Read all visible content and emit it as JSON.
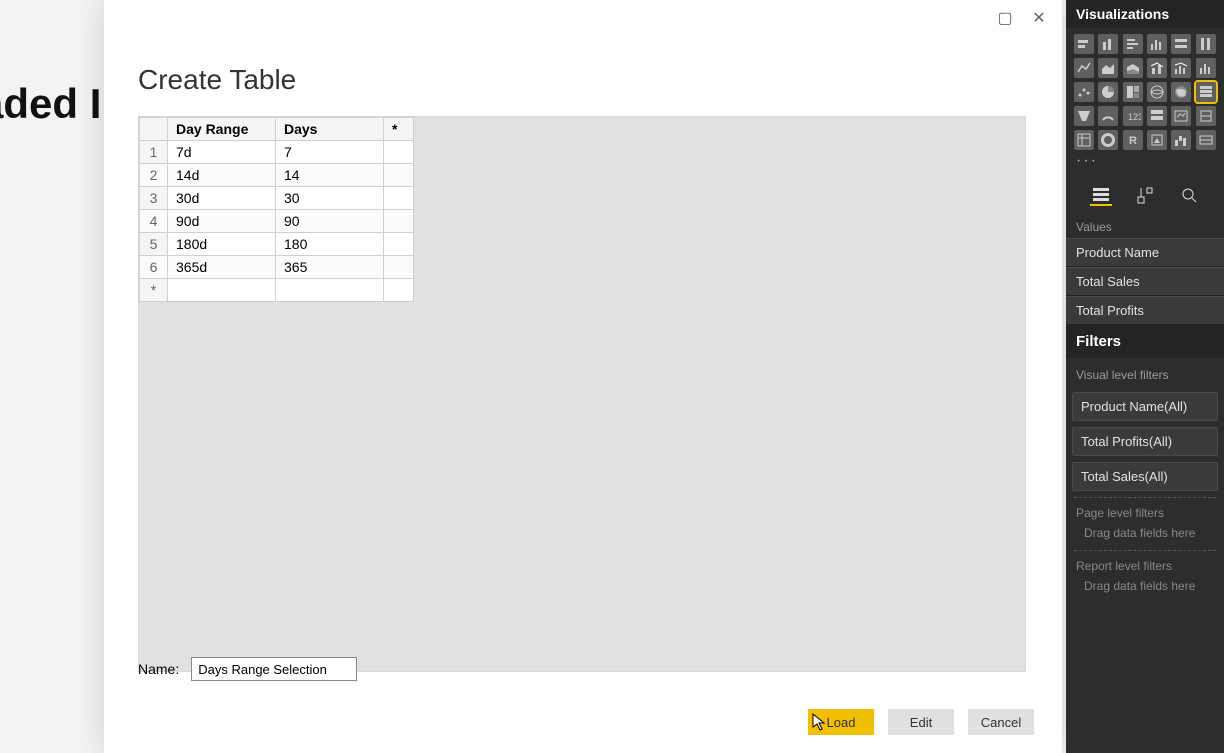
{
  "background": {
    "text_fragment": "aded I"
  },
  "dialog": {
    "title": "Create Table",
    "sys": {
      "maximize_glyph": "▢",
      "close_glyph": "✕"
    },
    "table": {
      "headers": {
        "c1": "Day Range",
        "c2": "Days",
        "star": "*"
      },
      "rows": [
        {
          "idx": "1",
          "c1": "7d",
          "c2": "7"
        },
        {
          "idx": "2",
          "c1": "14d",
          "c2": "14"
        },
        {
          "idx": "3",
          "c1": "30d",
          "c2": "30"
        },
        {
          "idx": "4",
          "c1": "90d",
          "c2": "90"
        },
        {
          "idx": "5",
          "c1": "180d",
          "c2": "180"
        },
        {
          "idx": "6",
          "c1": "365d",
          "c2": "365"
        }
      ],
      "new_row_glyph": "*"
    },
    "name_label": "Name:",
    "name_value": "Days Range Selection",
    "buttons": {
      "load": "Load",
      "edit": "Edit",
      "cancel": "Cancel"
    }
  },
  "right_pane": {
    "header": "Visualizations",
    "more": "···",
    "values_label": "Values",
    "values": [
      "Product Name",
      "Total Sales",
      "Total Profits"
    ],
    "filters_header": "Filters",
    "visual_level_label": "Visual level filters",
    "visual_filters": [
      "Product Name(All)",
      "Total Profits(All)",
      "Total Sales(All)"
    ],
    "page_level_label": "Page level filters",
    "drag_hint_1": "Drag data fields here",
    "report_level_label": "Report level filters",
    "drag_hint_2": "Drag data fields here"
  }
}
